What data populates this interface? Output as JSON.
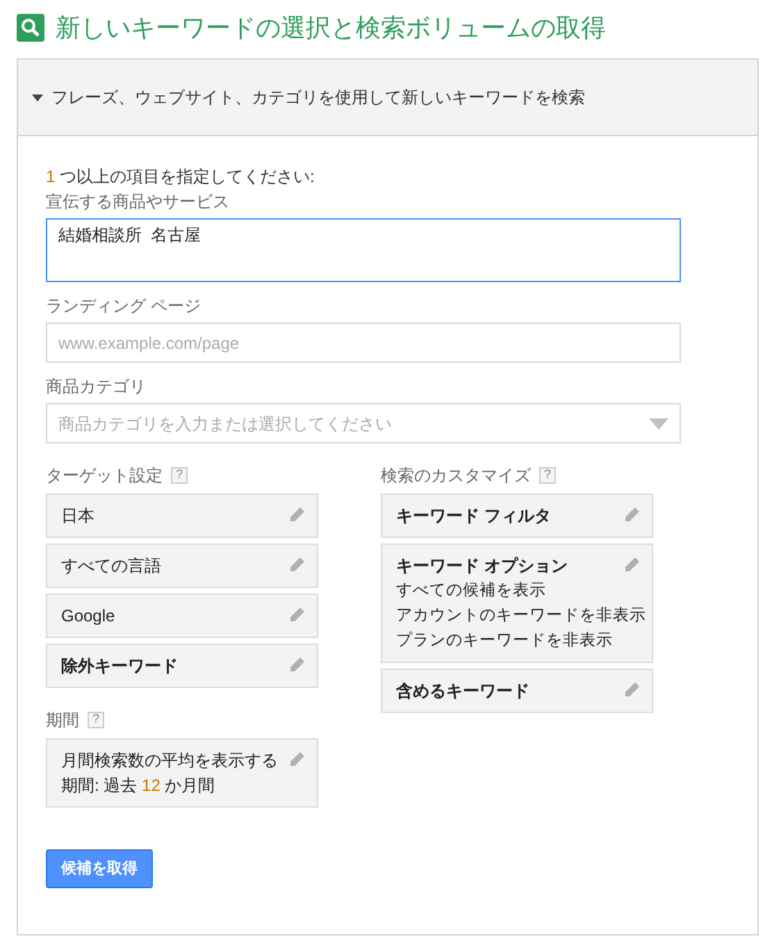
{
  "title": "新しいキーワードの選択と検索ボリュームの取得",
  "section": {
    "label": "フレーズ、ウェブサイト、カテゴリを使用して新しいキーワードを検索",
    "expanded": true
  },
  "instruction": {
    "number": "1",
    "text": " つ以上の項目を指定してください:"
  },
  "fields": [
    {
      "label": "宣伝する商品やサービス",
      "kind": "textarea",
      "value": "結婚相談所  名古屋",
      "focused": true
    },
    {
      "label": "ランディング ページ",
      "kind": "text",
      "placeholder": "www.example.com/page",
      "focused": false
    },
    {
      "label": "商品カテゴリ",
      "kind": "select",
      "placeholder": "商品カテゴリを入力または選択してください",
      "focused": false
    }
  ],
  "columns": [
    {
      "groups": [
        {
          "heading": "ターゲット設定",
          "help": "?",
          "cards": [
            {
              "title": "日本",
              "bold": false
            },
            {
              "title": "すべての言語",
              "bold": false
            },
            {
              "title": "Google",
              "bold": false
            },
            {
              "title": "除外キーワード",
              "bold": true
            }
          ]
        },
        {
          "heading": "期間",
          "help": "?",
          "cards": [
            {
              "title": "月間検索数の平均を表示する",
              "bold": false,
              "period": {
                "prefix": "期間: 過去 ",
                "number": "12",
                "suffix": " か月間"
              }
            }
          ]
        }
      ]
    },
    {
      "groups": [
        {
          "heading": "検索のカスタマイズ",
          "help": "?",
          "cards": [
            {
              "title": "キーワード フィルタ",
              "bold": true
            },
            {
              "title": "キーワード オプション",
              "bold": true,
              "lines": [
                "すべての候補を表示",
                "アカウントのキーワードを非表示",
                "プランのキーワードを非表示"
              ]
            },
            {
              "title": "含めるキーワード",
              "bold": true
            }
          ]
        }
      ]
    }
  ],
  "submit": "候補を取得"
}
